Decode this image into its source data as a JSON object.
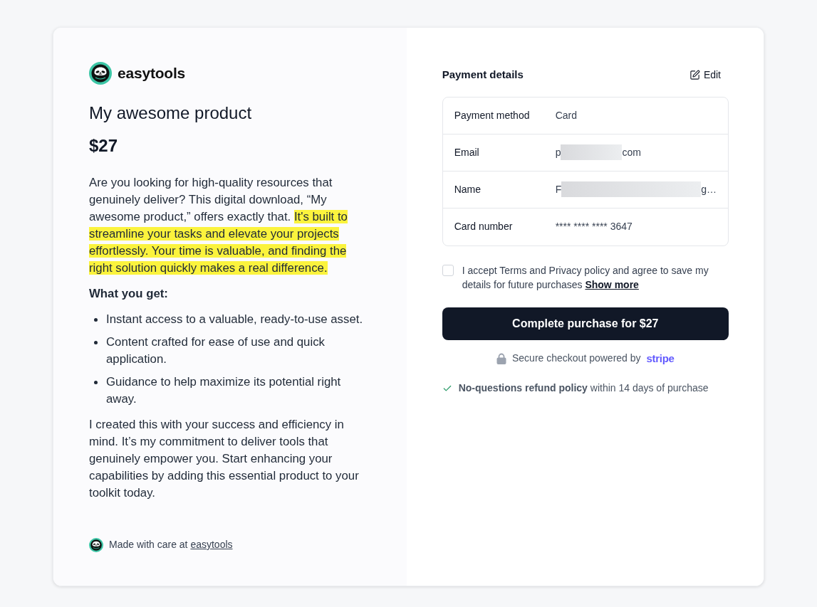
{
  "brand": {
    "name": "easytools"
  },
  "product": {
    "title": "My awesome product",
    "price": "$27"
  },
  "description": {
    "intro": [
      {
        "text": "Are you looking for high-quality resources that genuinely deliver? This digital download, “My awesome product,” offers exactly that. ",
        "highlighted": false
      },
      {
        "text": "It's built to streamline your tasks and elevate your projects effortlessly. Your time is valuable, and finding the right solution quickly makes a real difference.",
        "highlighted": true
      }
    ],
    "list_heading": "What you get:",
    "list_items": [
      "Instant access to a valuable, ready-to-use asset.",
      "Content crafted for ease of use and quick application.",
      "Guidance to help maximize its potential right away."
    ],
    "closing": "I created this with your success and efficiency in mind. It’s my commitment to deliver tools that genuinely empower you. Start enhancing your capabilities by adding this essential product to your toolkit today."
  },
  "footer": {
    "text": "Made with care at",
    "link": "easytools"
  },
  "payment": {
    "title": "Payment details",
    "edit_label": "Edit",
    "rows": [
      {
        "label": "Payment method",
        "kind": "plain",
        "value": "Card"
      },
      {
        "label": "Email",
        "kind": "redacted",
        "value_start": "p",
        "value_end": "com"
      },
      {
        "label": "Name",
        "kind": "redacted",
        "value_start": "F",
        "value_end": "g…"
      },
      {
        "label": "Card number",
        "kind": "plain",
        "value": "**** **** **** 3647"
      }
    ]
  },
  "consent": {
    "checked": false,
    "text": "I accept Terms and Privacy policy and agree to save my details for future purchases",
    "link": "Show more"
  },
  "purchase_button": "Complete purchase for $27",
  "secure_note": {
    "text": "Secure checkout powered by",
    "brand": "stripe"
  },
  "refund_note": "**No-questions refund policy** within 14 days of purchase"
}
